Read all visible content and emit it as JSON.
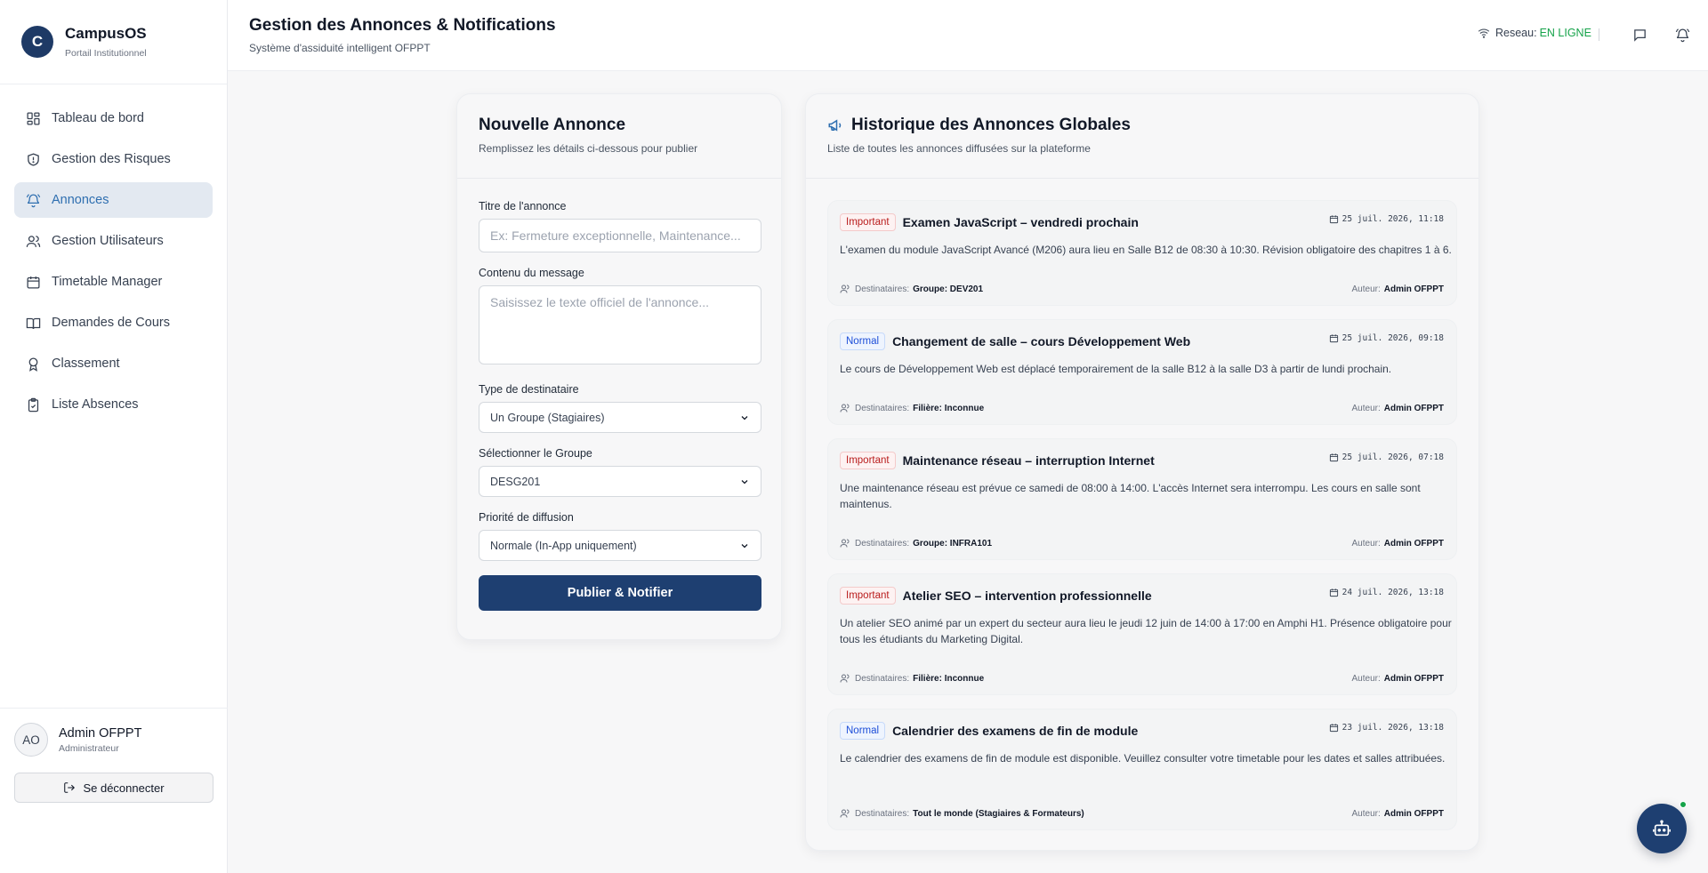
{
  "brand": {
    "logo_letter": "C",
    "title": "CampusOS",
    "subtitle": "Portail Institutionnel"
  },
  "sidebar": {
    "items": [
      {
        "label": "Tableau de bord",
        "icon": "dashboard-icon"
      },
      {
        "label": "Gestion des Risques",
        "icon": "shield-icon"
      },
      {
        "label": "Annonces",
        "icon": "bell-icon",
        "active": true
      },
      {
        "label": "Gestion Utilisateurs",
        "icon": "users-icon"
      },
      {
        "label": "Timetable Manager",
        "icon": "calendar-icon"
      },
      {
        "label": "Demandes de Cours",
        "icon": "book-icon"
      },
      {
        "label": "Classement",
        "icon": "award-icon"
      },
      {
        "label": "Liste Absences",
        "icon": "clipboard-icon"
      }
    ],
    "user": {
      "initials": "AO",
      "name": "Admin OFPPT",
      "role": "Administrateur"
    },
    "logout_label": "Se déconnecter"
  },
  "header": {
    "title": "Gestion des Annonces & Notifications",
    "subtitle": "Système d'assiduité intelligent OFPPT",
    "network_label": "Reseau:",
    "network_status": "EN LIGNE",
    "colors": {
      "online": "#16a34a"
    }
  },
  "form": {
    "title": "Nouvelle Annonce",
    "subtitle": "Remplissez les détails ci-dessous pour publier",
    "title_label": "Titre de l'annonce",
    "title_placeholder": "Ex: Fermeture exceptionnelle, Maintenance...",
    "content_label": "Contenu du message",
    "content_placeholder": "Saisissez le texte officiel de l'annonce...",
    "recipient_type_label": "Type de destinataire",
    "recipient_type_value": "Un Groupe (Stagiaires)",
    "group_label": "Sélectionner le Groupe",
    "group_value": "DESG201",
    "priority_label": "Priorité de diffusion",
    "priority_value": "Normale (In-App uniquement)",
    "submit_label": "Publier & Notifier",
    "colors": {
      "primary": "#1e3f71"
    }
  },
  "history": {
    "title": "Historique des Annonces Globales",
    "subtitle": "Liste de toutes les annonces diffusées sur la plateforme",
    "recipients_label": "Destinataires:",
    "author_label": "Auteur:",
    "items": [
      {
        "badge": "Important",
        "priority": "important",
        "title": "Examen JavaScript – vendredi prochain",
        "date": "25 juil. 2026, 11:18",
        "body": "L'examen du module JavaScript Avancé (M206) aura lieu en Salle B12 de 08:30 à 10:30. Révision obligatoire des chapitres 1 à 6.",
        "recipients": "Groupe: DEV201",
        "author": "Admin OFPPT"
      },
      {
        "badge": "Normal",
        "priority": "normal",
        "title": "Changement de salle – cours Développement Web",
        "date": "25 juil. 2026, 09:18",
        "body": "Le cours de Développement Web est déplacé temporairement de la salle B12 à la salle D3 à partir de lundi prochain.",
        "recipients": "Filière: Inconnue",
        "author": "Admin OFPPT"
      },
      {
        "badge": "Important",
        "priority": "important",
        "title": "Maintenance réseau – interruption Internet",
        "date": "25 juil. 2026, 07:18",
        "body": "Une maintenance réseau est prévue ce samedi de 08:00 à 14:00. L'accès Internet sera interrompu. Les cours en salle sont maintenus.",
        "recipients": "Groupe: INFRA101",
        "author": "Admin OFPPT"
      },
      {
        "badge": "Important",
        "priority": "important",
        "title": "Atelier SEO – intervention professionnelle",
        "date": "24 juil. 2026, 13:18",
        "body": "Un atelier SEO animé par un expert du secteur aura lieu le jeudi 12 juin de 14:00 à 17:00 en Amphi H1. Présence obligatoire pour tous les étudiants du Marketing Digital.",
        "recipients": "Filière: Inconnue",
        "author": "Admin OFPPT"
      },
      {
        "badge": "Normal",
        "priority": "normal",
        "title": "Calendrier des examens de fin de module",
        "date": "23 juil. 2026, 13:18",
        "body": "Le calendrier des examens de fin de module est disponible. Veuillez consulter votre timetable pour les dates et salles attribuées.",
        "recipients": "Tout le monde (Stagiaires & Formateurs)",
        "author": "Admin OFPPT"
      }
    ]
  }
}
